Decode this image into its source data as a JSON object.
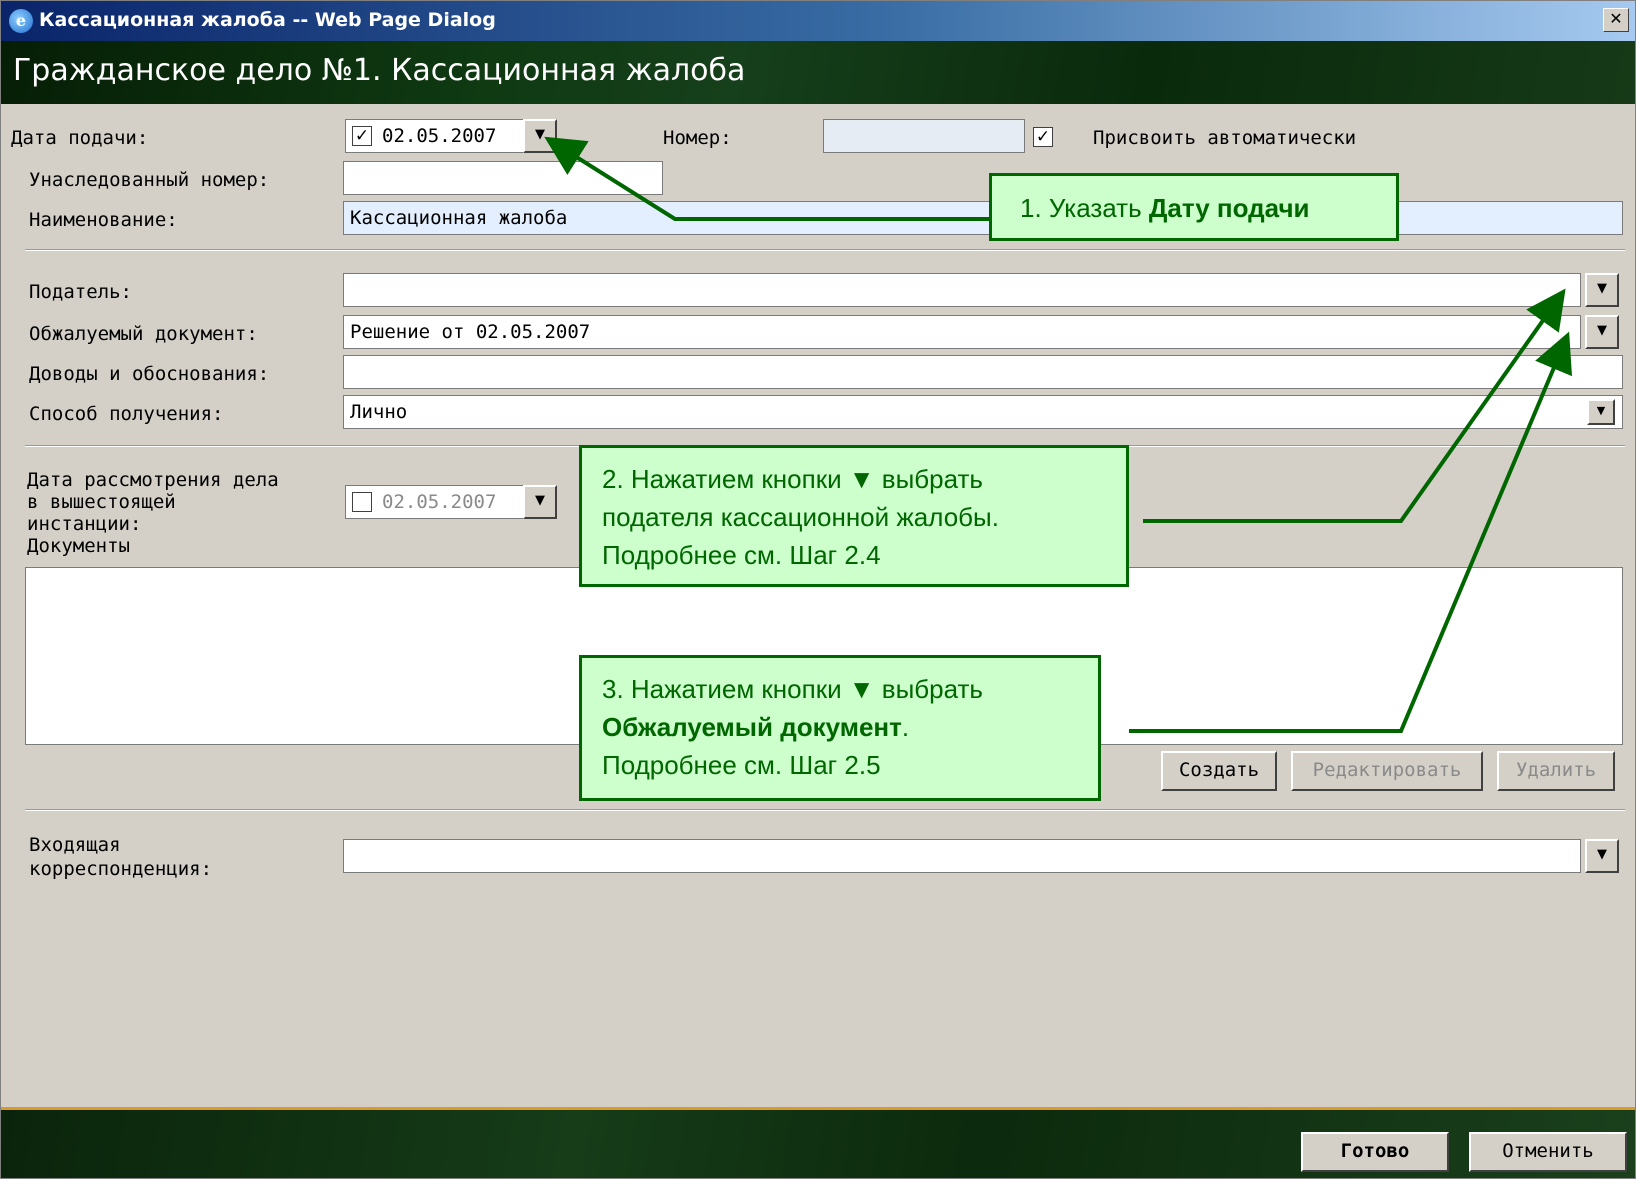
{
  "window": {
    "title": "Кассационная жалоба -- Web Page Dialog",
    "close": "✕"
  },
  "header": {
    "title": "Гражданское дело №1. Кассационная жалоба"
  },
  "form": {
    "date_label": "Дата подачи:",
    "date_value": "02.05.2007",
    "number_label": "Номер:",
    "auto_assign_label": "Присвоить автоматически",
    "inherited_number_label": "Унаследованный номер:",
    "name_label": "Наименование:",
    "name_value": "Кассационная жалоба",
    "filer_label": "Податель:",
    "appealed_doc_label": "Обжалуемый документ:",
    "appealed_doc_value": "Решение от 02.05.2007",
    "arguments_label": "Доводы и обоснования:",
    "receipt_label": "Способ получения:",
    "receipt_value": "Лично",
    "review_date_label_1": "Дата рассмотрения дела",
    "review_date_label_2": "в вышестоящей",
    "review_date_label_3": "инстанции:",
    "review_date_value": "02.05.2007",
    "documents_label": "Документы",
    "incoming_label_1": "Входящая",
    "incoming_label_2": "корреспонденция:"
  },
  "buttons": {
    "create": "Создать",
    "edit": "Редактировать",
    "delete": "Удалить",
    "done": "Готово",
    "cancel": "Отменить"
  },
  "callouts": {
    "c1": {
      "prefix": "1. Указать ",
      "bold": "Дату подачи"
    },
    "c2": {
      "line1": "2. Нажатием кнопки ▼ выбрать",
      "line2": "подателя кассационной жалобы.",
      "line3": "Подробнее см. Шаг 2.4"
    },
    "c3": {
      "line1": "3. Нажатием кнопки ▼ выбрать",
      "bold": "Обжалуемый документ",
      "after_bold": ".",
      "line3": "Подробнее см. Шаг 2.5"
    }
  },
  "colors": {
    "callout_bg": "#ccffcc",
    "callout_border": "#006600",
    "arrow": "#006600",
    "header_bg": "#0f3a12",
    "footer_rule": "#d99a2b"
  },
  "icons": {
    "dropdown": "▼",
    "checked": "✓"
  }
}
